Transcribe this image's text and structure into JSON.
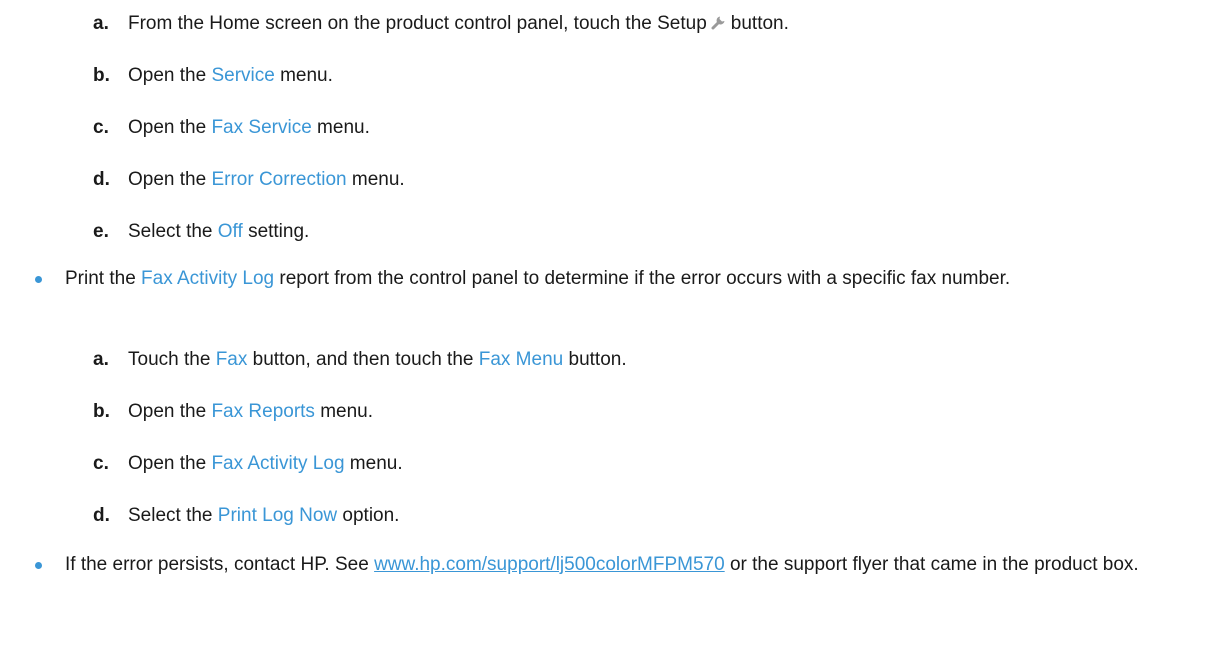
{
  "ecm_steps": [
    {
      "letter": "a.",
      "pre": "From the Home screen on the product control panel, touch the Setup",
      "post": "button.",
      "icon": "wrench-icon"
    },
    {
      "letter": "b.",
      "pre": "Open the",
      "hl": "Service",
      "post": "menu."
    },
    {
      "letter": "c.",
      "pre": "Open the",
      "hl": "Fax Service",
      "post": "menu."
    },
    {
      "letter": "d.",
      "pre": "Open the",
      "hl": "Error Correction",
      "post": "menu."
    },
    {
      "letter": "e.",
      "pre": "Select the",
      "hl": "Off",
      "post": "setting."
    }
  ],
  "bullet_activity_log": {
    "pre": "Print the",
    "hl": "Fax Activity Log",
    "post": "report from the control panel to determine if the error occurs with a specific fax number."
  },
  "log_steps": [
    {
      "letter": "a.",
      "pre": "Touch the",
      "hl": "Fax",
      "mid": "button, and then touch the",
      "hl2": "Fax Menu",
      "post": "button."
    },
    {
      "letter": "b.",
      "pre": "Open the",
      "hl": "Fax Reports",
      "post": "menu."
    },
    {
      "letter": "c.",
      "pre": "Open the",
      "hl": "Fax Activity Log",
      "post": "menu."
    },
    {
      "letter": "d.",
      "pre": "Select the",
      "hl": "Print Log Now",
      "post": "option."
    }
  ],
  "bullet_contact": {
    "pre": "If the error persists, contact HP. See",
    "link": "www.hp.com/support/lj500colorMFPM570",
    "post": "or the support flyer that came in the product box."
  },
  "colors": {
    "accent": "#3a96d6",
    "text": "#1a1a1a"
  }
}
